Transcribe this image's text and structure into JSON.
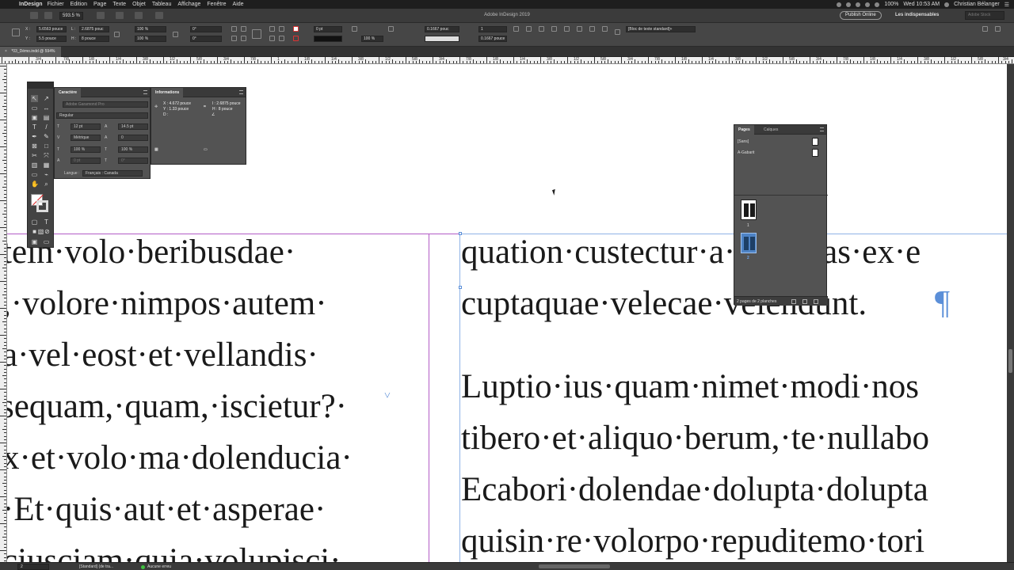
{
  "menubar": {
    "apple": "",
    "app_name": "InDesign",
    "items": [
      "Fichier",
      "Edition",
      "Page",
      "Texte",
      "Objet",
      "Tableau",
      "Affichage",
      "Fenêtre",
      "Aide"
    ],
    "battery": "100%",
    "datetime": "Wed 10:53 AM",
    "user": "Christian Bélanger"
  },
  "appbar": {
    "zoom": "593.5 %",
    "title": "Adobe InDesign 2019",
    "publish_label": "Publish Online",
    "workspace": "Les indispensables",
    "stock_placeholder": "Adobe Stock"
  },
  "control": {
    "x_label": "X :",
    "x_value": "5.6563 pouce",
    "y_label": "Y :",
    "y_value": "5.5 pouce",
    "w_label": "L :",
    "w_value": "2.6875 pouc",
    "h_label": "H :",
    "h_value": "8 pouce",
    "scale_x": "100 %",
    "scale_y": "100 %",
    "angle": "0°",
    "shear": "0°",
    "stroke_weight": "0 pt",
    "opacity": "100 %",
    "offset_1": "0.1667 pouc",
    "offset_2": "0.1667 pouc",
    "columns": "1",
    "gutter": "0.1667 pouce",
    "object_style": "[Bloc de texte standard]+"
  },
  "document": {
    "tab_label": "*03_Démo.indd @ 594%"
  },
  "ruler": {
    "labels": [
      "3/4",
      "7/8",
      "1/8",
      "1/4",
      "3/8",
      "1/2",
      "5/8",
      "3/4",
      "7/8",
      "1",
      "1/8",
      "1/4",
      "3/8",
      "1/2",
      "5/8",
      "3/4",
      "7/8",
      "1/8",
      "1/4",
      "3/8",
      "1/2",
      "5/8",
      "3/4",
      "7/8",
      "1/8",
      "1/4",
      "3/8",
      "1/2",
      "5/8",
      "3/4",
      "7/8",
      "1/8",
      "1/4",
      "3/8",
      "1/2",
      "5/8",
      "3/4"
    ]
  },
  "left_column": [
    "tein·volo·beribusdae·",
    ",·volore·nimpos·autem·",
    "a·vel·eost·et·vellandis·",
    "sequam,·quam,·iscietur?·",
    "x·et·volo·ma·dolenducia·",
    "·Et·quis·aut·et·asperae·",
    "ciusciam·quia·volupisci·"
  ],
  "right_column": [
    "quation·custectur·a·voluptas·ex·e",
    "cuptaquae·velecae·velendunt.",
    "",
    "Luptio·ius·quam·nimet·modi·nos",
    "tibero·et·aliquo·berum,·te·nullabo",
    "Ecabori·dolendae·dolupta·dolupta",
    "quisin·re·volorpo·repuditemo·tori"
  ],
  "pilcrow": "¶",
  "character_panel": {
    "tab": "Caractère",
    "font": "Adobe Garamond Pro",
    "style": "Regular",
    "size": "12 pt",
    "leading": "14.5 pt",
    "kerning": "Métrique",
    "tracking": "0",
    "vscale": "100 %",
    "hscale": "100 %",
    "baseline": "0 pt",
    "skew": "0°",
    "lang_label": "Langue :",
    "lang_value": "Français : Canada"
  },
  "info_panel": {
    "tab": "Informations",
    "x": "X : 4.672 pouce",
    "y": "Y : 1.33 pouce",
    "d": "D :",
    "w": "l : 2.6875 pouce",
    "h": "H : 8 pouce"
  },
  "pages_panel": {
    "tab_pages": "Pages",
    "tab_layers": "Calques",
    "masters": [
      "[Sans]",
      "A-Gabarit"
    ],
    "page_numbers": [
      "1",
      "2"
    ],
    "footer": "2 pages de 2 planches"
  },
  "status": {
    "page": "2",
    "style": "[Standard] (de tra...",
    "errors": "Aucune erreu"
  }
}
